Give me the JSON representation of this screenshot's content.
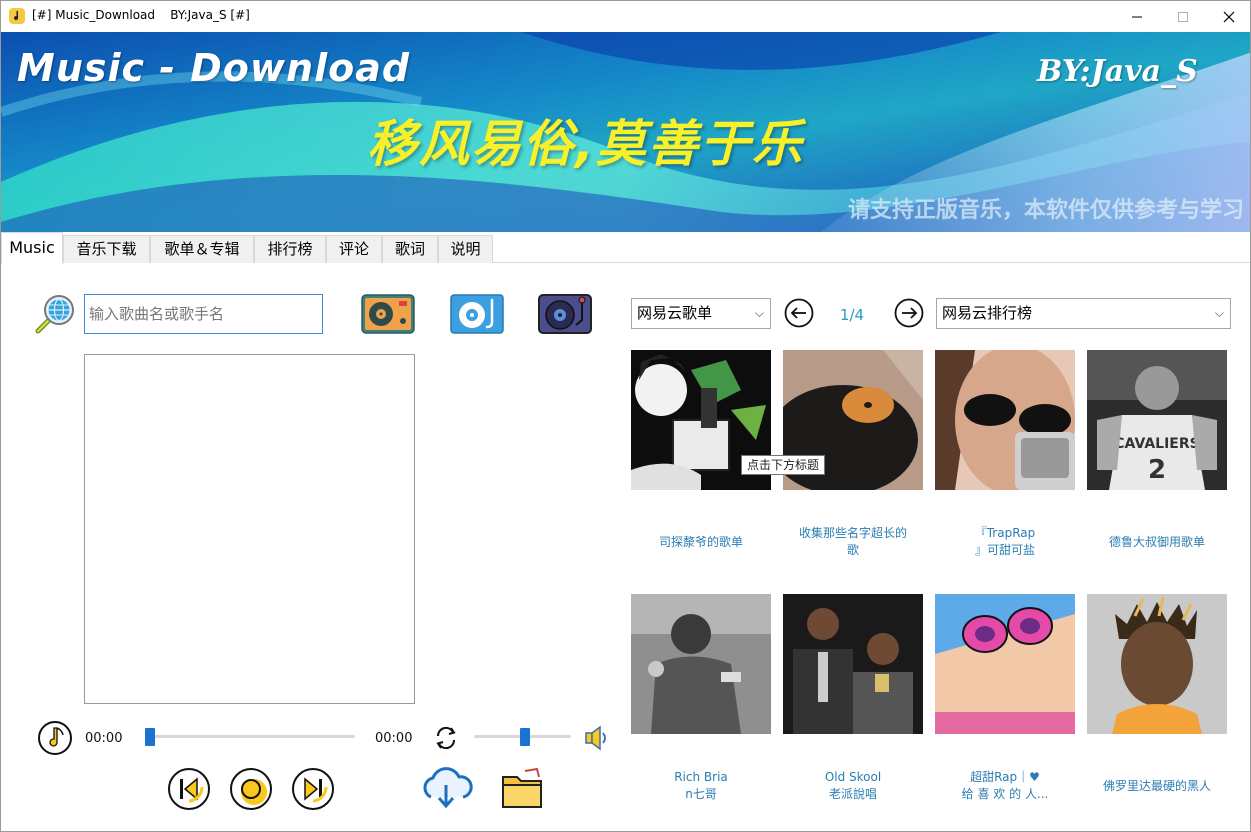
{
  "window": {
    "title": "[#] Music_Download    BY:Java_S [#]"
  },
  "banner": {
    "title": "Music - Download",
    "author": "BY:Java_S",
    "slogan": "移风易俗,莫善于乐",
    "notice": "请支持正版音乐，本软件仅供参考与学习"
  },
  "tabs": [
    {
      "label": "Music",
      "active": true
    },
    {
      "label": "音乐下载"
    },
    {
      "label": "歌单＆专辑"
    },
    {
      "label": "排行榜"
    },
    {
      "label": "评论"
    },
    {
      "label": "歌词"
    },
    {
      "label": "说明"
    }
  ],
  "search": {
    "placeholder": "输入歌曲名或歌手名",
    "value": ""
  },
  "player": {
    "current_time": "00:00",
    "total_time": "00:00",
    "progress": 0.0,
    "volume": 0.5
  },
  "playlist_panel": {
    "source_select": "网易云歌单",
    "page_indicator": "1/4",
    "chart_select": "网易云排行榜",
    "tooltip": "点击下方标题",
    "playlists": [
      {
        "title_line1": "司探漦爷的歌单",
        "title_line2": ""
      },
      {
        "title_line1": "收集那些名字超长的",
        "title_line2": "歌"
      },
      {
        "title_line1": "『TrapRap",
        "title_line2": "』可甜可盐"
      },
      {
        "title_line1": "德鲁大叔御用歌单",
        "title_line2": ""
      },
      {
        "title_line1": "Rich Bria",
        "title_line2": "n七哥"
      },
      {
        "title_line1": "Old Skool",
        "title_line2": "老派說唱"
      },
      {
        "title_line1": "超甜Rap｜♥",
        "title_line2": "给 喜 欢 的 人..."
      },
      {
        "title_line1": "佛罗里达最硬的黑人",
        "title_line2": ""
      }
    ]
  },
  "colors": {
    "accent_blue": "#1a73d0",
    "label_blue": "#2a7db3",
    "slogan_yellow": "#f7f02a",
    "control_yellow": "#f9c81a"
  },
  "icons": {
    "globe_search": "globe-search-icon",
    "player1": "record-player-icon",
    "player2": "cd-player-icon",
    "player3": "turntable-icon",
    "music_note": "music-note-icon",
    "loop": "loop-icon",
    "volume": "volume-icon",
    "prev": "previous-icon",
    "play": "play-stop-icon",
    "next": "next-icon",
    "download": "cloud-download-icon",
    "folder": "folder-icon"
  }
}
